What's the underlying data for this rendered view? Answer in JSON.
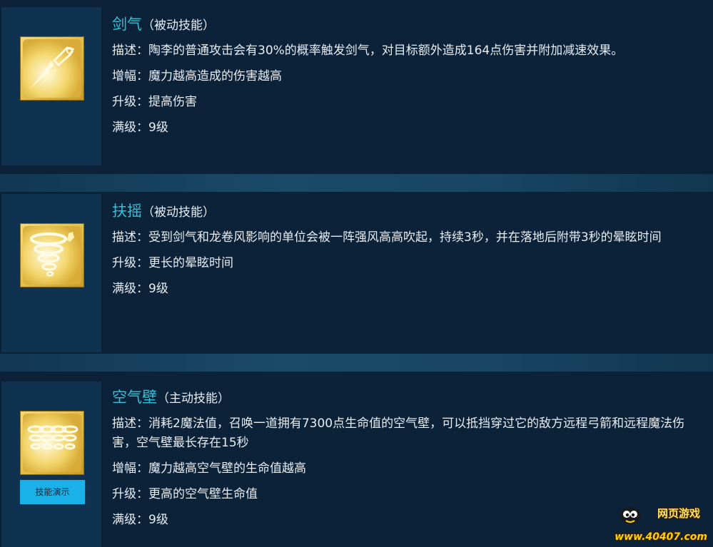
{
  "skills": [
    {
      "name": "剑气",
      "type": "（被动技能）",
      "description": "描述：陶李的普通攻击会有30%的概率触发剑气，对目标额外造成164点伤害并附加减速效果。",
      "attributes": [
        "增幅：魔力越高造成的伤害越高",
        "升级：提高伤害",
        "满级：9级"
      ],
      "icon": "sword-qi-icon"
    },
    {
      "name": "扶摇",
      "type": "（被动技能）",
      "description": "描述：受到剑气和龙卷风影响的单位会被一阵强风高高吹起，持续3秒，并在落地后附带3秒的晕眩时间",
      "attributes": [
        "升级：更长的晕眩时间",
        "满级：9级"
      ],
      "icon": "tornado-icon"
    },
    {
      "name": "空气壁",
      "type": "（主动技能）",
      "description": "描述：消耗2魔法值，召唤一道拥有7300点生命值的空气壁，可以抵挡穿过它的敌方远程弓箭和远程魔法伤害，空气壁最长存在15秒",
      "attributes": [
        "增幅：魔力越高空气壁的生命值越高",
        "升级：更高的空气壁生命值",
        "满级：9级"
      ],
      "icon": "air-wall-icon",
      "demo_button": "技能演示"
    }
  ],
  "watermark": {
    "title": "网页游戏",
    "url": "www.40407.com"
  },
  "colors": {
    "background": "#0b2239",
    "icon_panel": "#0f3250",
    "skill_name": "#2fc2d8",
    "demo_button": "#1ab1e8"
  }
}
